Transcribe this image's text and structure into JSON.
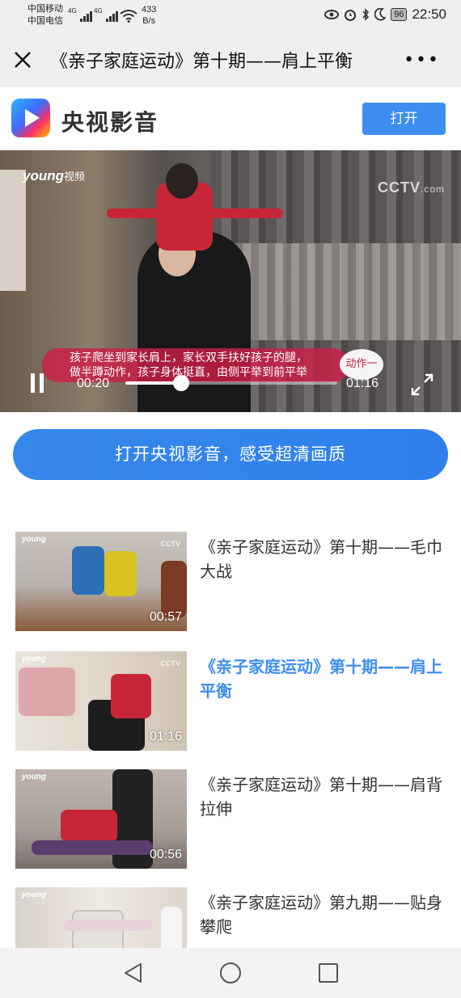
{
  "status_bar": {
    "carrier1": "中国移动",
    "carrier2": "中国电信",
    "net_label1": "4G",
    "net_label2": "4G",
    "net_speed_value": "433",
    "net_speed_unit": "B/s",
    "battery": "96",
    "time": "22:50"
  },
  "title_bar": {
    "title": "《亲子家庭运动》第十期——肩上平衡",
    "more": "•••"
  },
  "app_banner": {
    "brand": "央视影音",
    "open_label": "打开"
  },
  "video": {
    "watermark_left": "young",
    "watermark_left_suffix": "视频",
    "watermark_right": "CCTV",
    "watermark_right_suffix": ".com",
    "subtitle_line1": "孩子爬坐到家长肩上，家长双手扶好孩子的腿，",
    "subtitle_line2": "做半蹲动作，孩子身体挺直，由侧平举到前平举",
    "action_badge": "动作一",
    "current_time": "00:20",
    "total_time": "01:16",
    "progress": 0.263
  },
  "hq_button": "打开央视影音，感受超清画质",
  "list": [
    {
      "title": "《亲子家庭运动》第十期——毛巾大战",
      "duration": "00:57",
      "active": false
    },
    {
      "title": "《亲子家庭运动》第十期——肩上平衡",
      "duration": "01:16",
      "active": true
    },
    {
      "title": "《亲子家庭运动》第十期——肩背拉伸",
      "duration": "00:56",
      "active": false
    },
    {
      "title": "《亲子家庭运动》第九期——贴身攀爬",
      "duration": "",
      "active": false
    }
  ],
  "thumb_watermark": "young",
  "thumb_cctv": "CCTV",
  "colors": {
    "accent": "#3d8ef0",
    "subtitle_bg": "#cc1e46"
  }
}
